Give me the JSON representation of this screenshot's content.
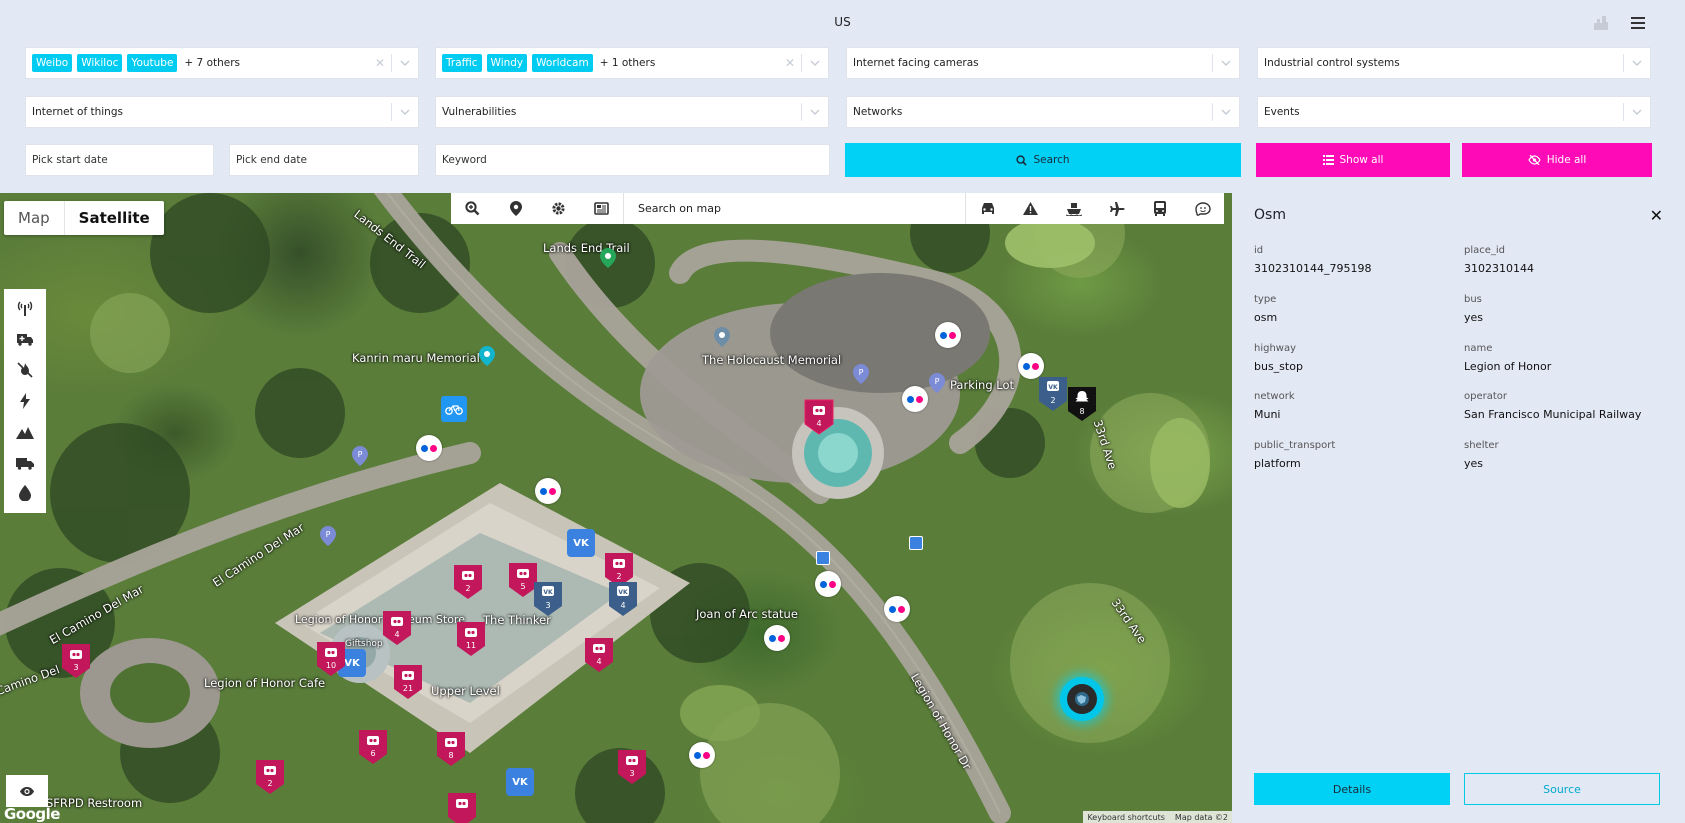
{
  "header": {
    "title": "US",
    "icons": [
      "city-icon",
      "menu-icon"
    ]
  },
  "filters": {
    "social": {
      "tags": [
        "Weibo",
        "Wikiloc",
        "Youtube"
      ],
      "more": "+ 7 others"
    },
    "cameras": {
      "tags": [
        "Traffic",
        "Windy",
        "Worldcam"
      ],
      "more": "+ 1 others"
    },
    "internet_facing": "Internet facing cameras",
    "ics": "Industrial control systems",
    "iot": "Internet of things",
    "vulnerabilities": "Vulnerabilities",
    "networks": "Networks",
    "events": "Events",
    "start_date": "Pick start date",
    "end_date": "Pick end date",
    "keyword": "Keyword",
    "search_label": "Search",
    "show_all_label": "Show all",
    "hide_all_label": "Hide all"
  },
  "map": {
    "type_map": "Map",
    "type_satellite": "Satellite",
    "search_placeholder": "Search on map",
    "google": "Google",
    "footer_shortcuts": "Keyboard shortcuts",
    "footer_data": "Map data ©2",
    "labels": {
      "lands_end_trail_road": "Lands End Trail",
      "lands_end_trail_poi": "Lands End Trail",
      "kanrin": "Kanrin maru Memorial",
      "holocaust": "The Holocaust Memorial",
      "parking": "Parking Lot",
      "joan": "Joan of Arc statue",
      "legion_museum": "Legion of Honor Museum Store",
      "giftshop": "Giftshop",
      "thinker": "The Thinker",
      "legion_cafe": "Legion of Honor Cafe",
      "upper_level": "Upper Level",
      "restroom": "SFRPD Restroom",
      "camino1": "El Camino Del Mar",
      "camino2": "El Camino Del Mar",
      "camino3": "Camino Del",
      "ave33a": "33rd Ave",
      "ave33b": "33rd Ave",
      "legion_dr": "Legion of Honor Dr"
    },
    "clusters": {
      "c1": "4",
      "c2": "2",
      "c3": "5",
      "c4": "2",
      "c5": "4",
      "c6": "11",
      "c7": "10",
      "c8": "21",
      "c9": "4",
      "c10": "3",
      "c11": "6",
      "c12": "8",
      "c13": "2",
      "c14": "3",
      "v1": "3",
      "v2": "4",
      "v3": "2",
      "s1": "8"
    }
  },
  "detail": {
    "title": "Osm",
    "fields": [
      {
        "key": "id",
        "value": "3102310144_795198"
      },
      {
        "key": "place_id",
        "value": "3102310144"
      },
      {
        "key": "type",
        "value": "osm"
      },
      {
        "key": "bus",
        "value": "yes"
      },
      {
        "key": "highway",
        "value": "bus_stop"
      },
      {
        "key": "name",
        "value": "Legion of Honor"
      },
      {
        "key": "network",
        "value": "Muni"
      },
      {
        "key": "operator",
        "value": "San Francisco Municipal Railway"
      },
      {
        "key": "public_transport",
        "value": "platform"
      },
      {
        "key": "shelter",
        "value": "yes"
      }
    ],
    "details_label": "Details",
    "source_label": "Source"
  },
  "colors": {
    "accent": "#00d1f5",
    "pink": "#ff0ab7",
    "camera_marker": "#c2185b",
    "vk_marker": "#3b82e0"
  }
}
